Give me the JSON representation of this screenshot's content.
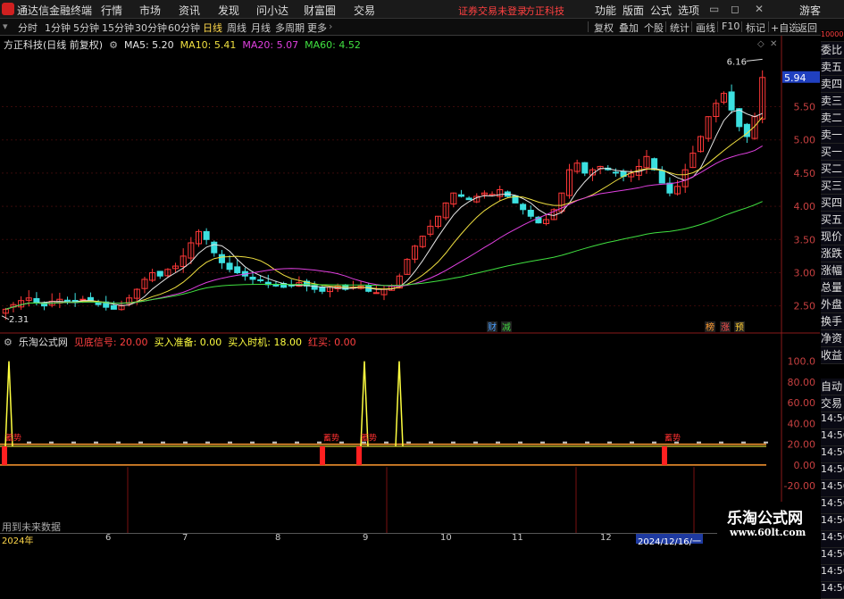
{
  "app": {
    "title": "通达信金融终端",
    "menu": [
      "行情",
      "市场",
      "资讯",
      "发现",
      "问小达",
      "财富圈",
      "交易"
    ],
    "notice_left": "证券交易未登录",
    "notice_right": "方正科技",
    "right_menu": [
      "功能",
      "版面",
      "公式",
      "选项"
    ],
    "guest": "游客"
  },
  "toolbar": {
    "periods": [
      "分时",
      "1分钟",
      "5分钟",
      "15分钟",
      "30分钟",
      "60分钟",
      "日线",
      "周线",
      "月线",
      "多周期",
      "更多"
    ],
    "active": "日线",
    "right_buttons": [
      "复权",
      "叠加",
      "个股",
      "统计",
      "画线",
      "F10",
      "标记",
      "+自选",
      "返回"
    ]
  },
  "main_chart": {
    "title": "方正科技(日线 前复权)",
    "ma": [
      {
        "label": "MA5: 5.20",
        "color": "#e6e6e6"
      },
      {
        "label": "MA10: 5.41",
        "color": "#f0e040"
      },
      {
        "label": "MA20: 5.07",
        "color": "#e040e0"
      },
      {
        "label": "MA60: 4.52",
        "color": "#40e040"
      }
    ],
    "high_label": "6.16",
    "low_label": "2.31",
    "price_tag": "5.94",
    "event_markers": [
      {
        "text": "财",
        "color": "#4aa0ff"
      },
      {
        "text": "减",
        "color": "#40d040"
      },
      {
        "text": "榜",
        "color": "#ff9a30"
      },
      {
        "text": "涨",
        "color": "#ff5050"
      },
      {
        "text": "预",
        "color": "#ffcc30"
      }
    ]
  },
  "indicator": {
    "name": "乐淘公式网",
    "items": [
      {
        "label": "见底信号: 20.00",
        "color": "#ff4040"
      },
      {
        "label": "买入准备: 0.00",
        "color": "#ffff40"
      },
      {
        "label": "买入时机: 18.00",
        "color": "#ffff40"
      },
      {
        "label": "红买: 0.00",
        "color": "#ff4040"
      }
    ],
    "buy_tag": "蓄势",
    "future_note": "用到未来数据"
  },
  "sidebar": {
    "top_label": "10000",
    "items": [
      "委比",
      "卖五",
      "卖四",
      "卖三",
      "卖二",
      "卖一",
      "买一",
      "买二",
      "买三",
      "买四",
      "买五",
      "现价",
      "涨跌",
      "涨幅",
      "总量",
      "外盘",
      "换手",
      "净资",
      "收益",
      "自动",
      "交易"
    ],
    "time_ticks": [
      "14:56",
      "14:56",
      "14:56",
      "14:56",
      "14:56",
      "14:56",
      "14:56",
      "14:56",
      "14:56",
      "14:56",
      "14:56"
    ]
  },
  "x_axis": {
    "labels": [
      "2024年",
      "6",
      "7",
      "8",
      "9",
      "10",
      "11",
      "12"
    ],
    "cursor_date": "2024/12/16/一"
  },
  "watermark": {
    "main": "乐淘公式网",
    "url": "www.60lt.com"
  },
  "chart_data": [
    {
      "type": "candlestick",
      "title": "方正科技(日线 前复权)",
      "y_axis_ticks": [
        "5.50",
        "5.00",
        "4.50",
        "4.00",
        "3.50",
        "3.00",
        "2.50"
      ],
      "ylim": [
        2.2,
        6.3
      ],
      "x_labels": [
        "2024年",
        "6",
        "7",
        "8",
        "9",
        "10",
        "11",
        "12"
      ],
      "annotations": {
        "high": 6.16,
        "low": 2.31,
        "current": 5.94
      },
      "series": [
        {
          "name": "MA5",
          "last": 5.2
        },
        {
          "name": "MA10",
          "last": 5.41
        },
        {
          "name": "MA20",
          "last": 5.07
        },
        {
          "name": "MA60",
          "last": 4.52
        }
      ],
      "close_series": [
        2.45,
        2.52,
        2.58,
        2.62,
        2.55,
        2.5,
        2.57,
        2.6,
        2.58,
        2.55,
        2.6,
        2.58,
        2.52,
        2.48,
        2.45,
        2.5,
        2.62,
        2.75,
        2.9,
        3.0,
        2.95,
        3.05,
        3.1,
        3.25,
        3.45,
        3.62,
        3.5,
        3.3,
        3.15,
        3.05,
        3.0,
        2.95,
        2.9,
        2.88,
        2.82,
        2.8,
        2.78,
        2.8,
        2.85,
        2.8,
        2.75,
        2.72,
        2.78,
        2.8,
        2.75,
        2.78,
        2.8,
        2.72,
        2.7,
        2.75,
        2.8,
        2.95,
        3.2,
        3.4,
        3.55,
        3.7,
        3.85,
        4.05,
        4.2,
        4.15,
        4.1,
        4.15,
        4.2,
        4.18,
        4.25,
        4.15,
        4.05,
        3.95,
        3.85,
        3.75,
        3.8,
        3.95,
        4.2,
        4.55,
        4.65,
        4.5,
        4.55,
        4.6,
        4.55,
        4.5,
        4.45,
        4.5,
        4.6,
        4.75,
        4.55,
        4.35,
        4.2,
        4.3,
        4.55,
        4.8,
        5.05,
        5.35,
        5.55,
        5.7,
        5.45,
        5.2,
        5.05,
        5.35,
        5.94
      ]
    },
    {
      "type": "line",
      "title": "乐淘公式网",
      "y_axis_ticks": [
        "100.0",
        "80.00",
        "60.00",
        "40.00",
        "20.00",
        "0.00",
        "-20.00"
      ],
      "ylim": [
        -25,
        110
      ],
      "series": [
        {
          "name": "见底信号",
          "last": 20.0
        },
        {
          "name": "买入准备",
          "last": 0.0
        },
        {
          "name": "买入时机",
          "last": 18.0
        },
        {
          "name": "红买",
          "last": 0.0
        }
      ],
      "spikes": [
        100,
        100,
        100
      ],
      "red_bars": 4
    }
  ]
}
